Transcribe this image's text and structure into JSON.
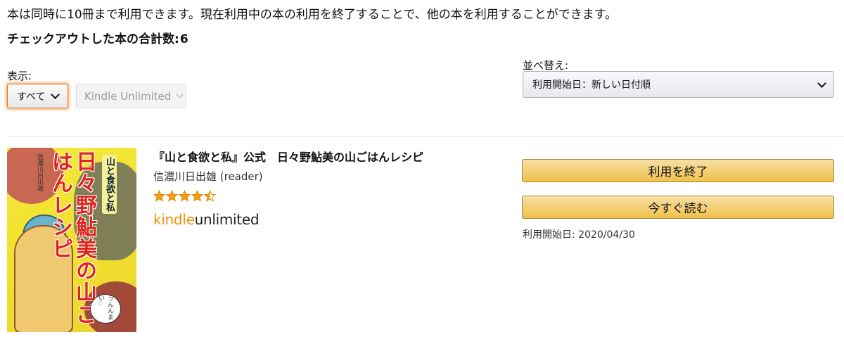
{
  "notice": "本は同時に10冊まで利用できます。現在利用中の本の利用を終了することで、他の本を利用することができます。",
  "total": {
    "label": "チェックアウトした本の合計数:",
    "count": "6"
  },
  "filter": {
    "label": "表示:",
    "selected": "すべて"
  },
  "format": {
    "selected": "Kindle Unlimited"
  },
  "sort": {
    "label": "並べ替え:",
    "selected": "利用開始日：新しい日付順"
  },
  "book": {
    "title": "『山と食欲と私』公式　日々野鮎美の山ごはんレシピ",
    "author": "信濃川日出雄 (reader)",
    "rating": 4.5,
    "rating_max": 5,
    "badge_kindle": "kindle",
    "badge_unlimited": "unlimited",
    "cover": {
      "title": "日々野鮎美の山ごはんレシピ",
      "series": "山と食欲と私",
      "author": "信濃川日出雄",
      "bubble": "うんんまい♡"
    },
    "return_button": "利用を終了",
    "read_button": "今すぐ読む",
    "acquired": "利用開始日: 2020/04/30"
  },
  "colors": {
    "button_top": "#f7dfa5",
    "button_bottom": "#f0c14b",
    "star": "#f0a010",
    "kindle_orange": "#f29000",
    "focus_ring": "#e77600"
  },
  "icons": {
    "dropdown": "chevron-down-icon",
    "star": "star-icon"
  }
}
